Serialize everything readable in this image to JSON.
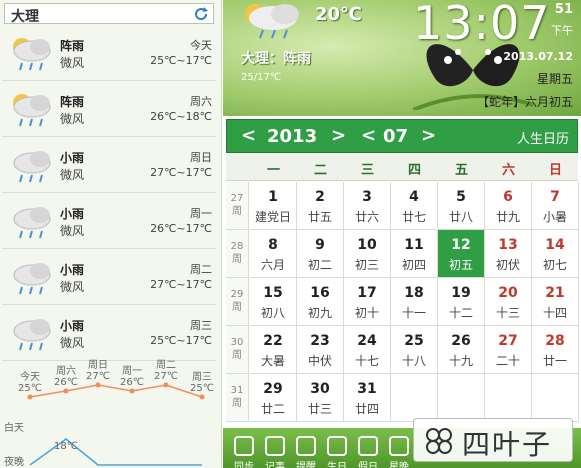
{
  "city": "大理",
  "forecast": [
    {
      "icon": "cloud-rain-sun-icon",
      "condition": "阵雨",
      "wind": "微风",
      "day": "今天",
      "temp": "25℃~17℃"
    },
    {
      "icon": "cloud-rain-sun-icon",
      "condition": "阵雨",
      "wind": "微风",
      "day": "周六",
      "temp": "26℃~18℃"
    },
    {
      "icon": "cloud-rain-icon",
      "condition": "小雨",
      "wind": "微风",
      "day": "周日",
      "temp": "27℃~17℃"
    },
    {
      "icon": "cloud-rain-icon",
      "condition": "小雨",
      "wind": "微风",
      "day": "周一",
      "temp": "26℃~17℃"
    },
    {
      "icon": "cloud-rain-icon",
      "condition": "小雨",
      "wind": "微风",
      "day": "周二",
      "temp": "27℃~17℃"
    },
    {
      "icon": "cloud-rain-icon",
      "condition": "小雨",
      "wind": "微风",
      "day": "周三",
      "temp": "25℃~17℃"
    }
  ],
  "trend": {
    "day_label": "白天",
    "night_label": "夜晚",
    "points": [
      {
        "day": "今天",
        "high": "25℃",
        "high_value": 25
      },
      {
        "day": "周六",
        "high": "26℃",
        "high_value": 26
      },
      {
        "day": "周日",
        "high": "27℃",
        "high_value": 27
      },
      {
        "day": "周一",
        "high": "26℃",
        "high_value": 26
      },
      {
        "day": "周二",
        "high": "27℃",
        "high_value": 27
      },
      {
        "day": "周三",
        "high": "25℃",
        "high_value": 25
      }
    ],
    "night_visible_value": "18℃",
    "colors": {
      "high": "#f28c5a",
      "low": "#4aa3df"
    }
  },
  "header": {
    "current_temp": "20℃",
    "weather": "大理：阵雨",
    "temp_range": "25/17℃",
    "time": "13:07",
    "seconds": "51",
    "ampm": "下午",
    "date": "2013.07.12",
    "weekday": "星期五",
    "lunar": "【蛇年】六月初五"
  },
  "calendar": {
    "year": "2013",
    "month": "07",
    "life_calendar": "人生日历",
    "prev_year": "<",
    "next_year": ">",
    "prev_month": "<",
    "next_month": ">",
    "week_header": [
      "一",
      "二",
      "三",
      "四",
      "五",
      "六",
      "日"
    ],
    "week_suffix": "周",
    "weeks": [
      {
        "num": "27",
        "days": [
          [
            "1",
            "建党日"
          ],
          [
            "2",
            "廿五"
          ],
          [
            "3",
            "廿六"
          ],
          [
            "4",
            "廿七"
          ],
          [
            "5",
            "廿八"
          ],
          [
            "6",
            "廿九"
          ],
          [
            "7",
            "小暑"
          ]
        ]
      },
      {
        "num": "28",
        "days": [
          [
            "8",
            "六月"
          ],
          [
            "9",
            "初二"
          ],
          [
            "10",
            "初三"
          ],
          [
            "11",
            "初四"
          ],
          [
            "12",
            "初五"
          ],
          [
            "13",
            "初伏"
          ],
          [
            "14",
            "初七"
          ]
        ]
      },
      {
        "num": "29",
        "days": [
          [
            "15",
            "初八"
          ],
          [
            "16",
            "初九"
          ],
          [
            "17",
            "初十"
          ],
          [
            "18",
            "十一"
          ],
          [
            "19",
            "十二"
          ],
          [
            "20",
            "十三"
          ],
          [
            "21",
            "十四"
          ]
        ]
      },
      {
        "num": "30",
        "days": [
          [
            "22",
            "大暑"
          ],
          [
            "23",
            "中伏"
          ],
          [
            "24",
            "十七"
          ],
          [
            "25",
            "十八"
          ],
          [
            "26",
            "十九"
          ],
          [
            "27",
            "二十"
          ],
          [
            "28",
            "廿一"
          ]
        ]
      },
      {
        "num": "31",
        "days": [
          [
            "29",
            "廿二"
          ],
          [
            "30",
            "廿三"
          ],
          [
            "31",
            "廿四"
          ],
          [
            "",
            ""
          ],
          [
            "",
            ""
          ],
          [
            "",
            ""
          ],
          [
            "",
            ""
          ]
        ]
      }
    ],
    "today": "12",
    "accent": "#2f9e44",
    "weekend_color": "#c0392b"
  },
  "toolbar": {
    "items": [
      {
        "label": "同步",
        "icon": "cloud-sync-icon"
      },
      {
        "label": "记事",
        "icon": "note-icon"
      },
      {
        "label": "提醒",
        "icon": "alarm-icon"
      },
      {
        "label": "生日",
        "icon": "birthday-icon"
      },
      {
        "label": "假日",
        "icon": "holiday-icon"
      },
      {
        "label": "星晚",
        "icon": "star-icon"
      }
    ]
  },
  "brand": {
    "text": "四叶子"
  }
}
